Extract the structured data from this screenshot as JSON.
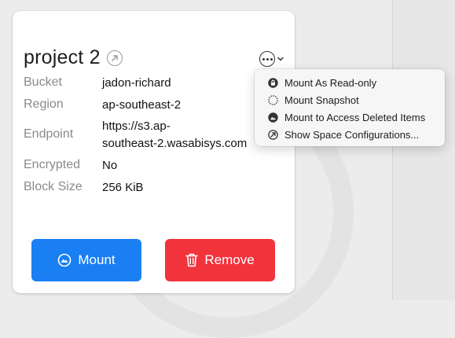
{
  "card": {
    "title": "project 2",
    "fields": [
      {
        "label": "Bucket",
        "value": "jadon-richard"
      },
      {
        "label": "Region",
        "value": "ap-southeast-2"
      },
      {
        "label": "Endpoint",
        "value_line1": "https://s3.ap-",
        "value_line2": "southeast-2.wasabisys.com"
      },
      {
        "label": "Encrypted",
        "value": "No"
      },
      {
        "label": "Block Size",
        "value": "256 KiB"
      }
    ],
    "mount_label": "Mount",
    "remove_label": "Remove"
  },
  "menu": {
    "items": [
      {
        "label": "Mount As Read-only",
        "icon": "lock-icon"
      },
      {
        "label": "Mount Snapshot",
        "icon": "snapshot-icon"
      },
      {
        "label": "Mount to Access Deleted Items",
        "icon": "mountain-icon"
      },
      {
        "label": "Show Space Configurations...",
        "icon": "compass-icon"
      }
    ]
  },
  "colors": {
    "mount_button": "#1a7ff2",
    "remove_button": "#f1333c"
  }
}
